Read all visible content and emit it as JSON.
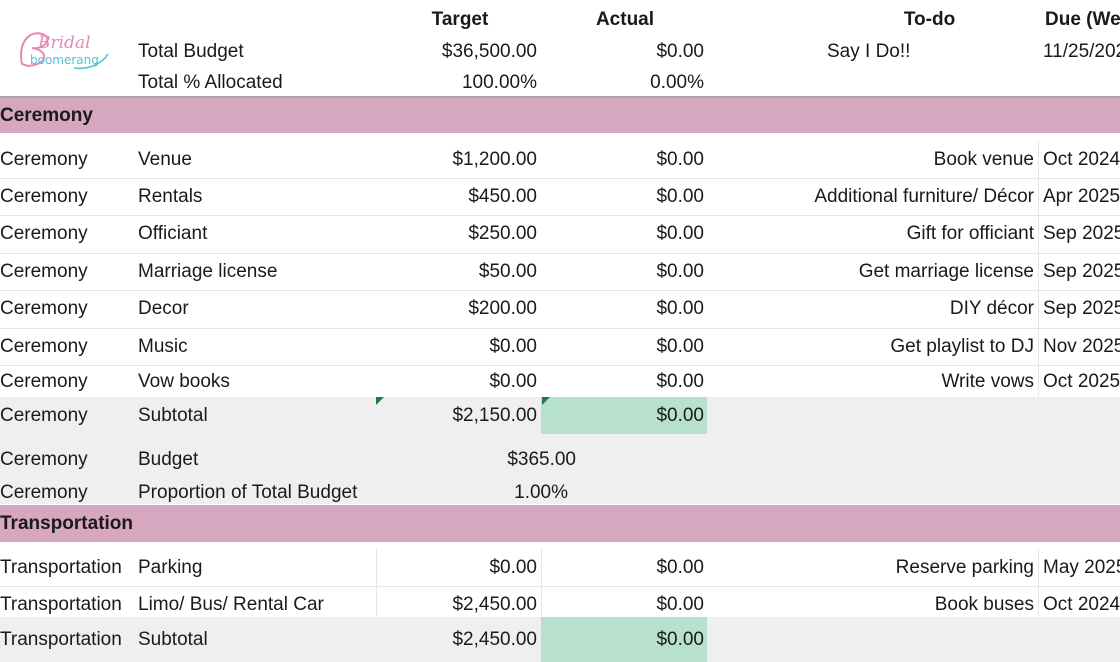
{
  "header": {
    "col_target": "Target",
    "col_actual": "Actual",
    "col_todo": "To-do",
    "col_due": "Due (We",
    "rows": [
      {
        "label": "Total Budget",
        "target": "$36,500.00",
        "actual": "$0.00",
        "todo": "Say I Do!!",
        "due": "11/25/202"
      },
      {
        "label": "Total % Allocated",
        "target": "100.00%",
        "actual": "0.00%",
        "todo": "",
        "due": ""
      }
    ]
  },
  "logo": {
    "line1": "Bridal",
    "line2": "boomerang",
    "colors": {
      "pink": "#e887b8",
      "teal": "#4fc3d6"
    }
  },
  "ceremony": {
    "title": "Ceremony",
    "items": [
      {
        "cat": "Ceremony",
        "item": "Venue",
        "target": "$1,200.00",
        "actual": "$0.00",
        "todo": "Book venue",
        "due": "Oct 2024"
      },
      {
        "cat": "Ceremony",
        "item": "Rentals",
        "target": "$450.00",
        "actual": "$0.00",
        "todo": "Additional furniture/ Décor",
        "due": "Apr 2025"
      },
      {
        "cat": "Ceremony",
        "item": "Officiant",
        "target": "$250.00",
        "actual": "$0.00",
        "todo": "Gift for officiant",
        "due": "Sep 2025"
      },
      {
        "cat": "Ceremony",
        "item": "Marriage license",
        "target": "$50.00",
        "actual": "$0.00",
        "todo": "Get marriage license",
        "due": "Sep 2025"
      },
      {
        "cat": "Ceremony",
        "item": "Decor",
        "target": "$200.00",
        "actual": "$0.00",
        "todo": "DIY décor",
        "due": "Sep 2025"
      },
      {
        "cat": "Ceremony",
        "item": "Music",
        "target": "$0.00",
        "actual": "$0.00",
        "todo": "Get playlist to DJ",
        "due": "Nov 2025"
      },
      {
        "cat": "Ceremony",
        "item": "Vow books",
        "target": "$0.00",
        "actual": "$0.00",
        "todo": "Write vows",
        "due": "Oct 2025"
      }
    ],
    "subtotal": {
      "cat": "Ceremony",
      "label": "Subtotal",
      "target": "$2,150.00",
      "actual": "$0.00"
    },
    "budget": {
      "cat": "Ceremony",
      "label": "Budget",
      "value": "$365.00"
    },
    "proportion": {
      "cat": "Ceremony",
      "label": "Proportion of Total Budget",
      "value": "1.00%"
    }
  },
  "transportation": {
    "title": "Transportation",
    "items": [
      {
        "cat": "Transportation",
        "item": "Parking",
        "target": "$0.00",
        "actual": "$0.00",
        "todo": "Reserve parking",
        "due": "May 2025"
      },
      {
        "cat": "Transportation",
        "item": "Limo/ Bus/ Rental Car",
        "target": "$2,450.00",
        "actual": "$0.00",
        "todo": "Book buses",
        "due": "Oct 2024"
      }
    ],
    "subtotal": {
      "cat": "Transportation",
      "label": "Subtotal",
      "target": "$2,450.00",
      "actual": "$0.00"
    }
  },
  "colors": {
    "section": "#d7a6bf",
    "subtotal_bg": "#efefef",
    "actual_highlight": "#b7e1cd",
    "comment_flag": "#188038"
  }
}
